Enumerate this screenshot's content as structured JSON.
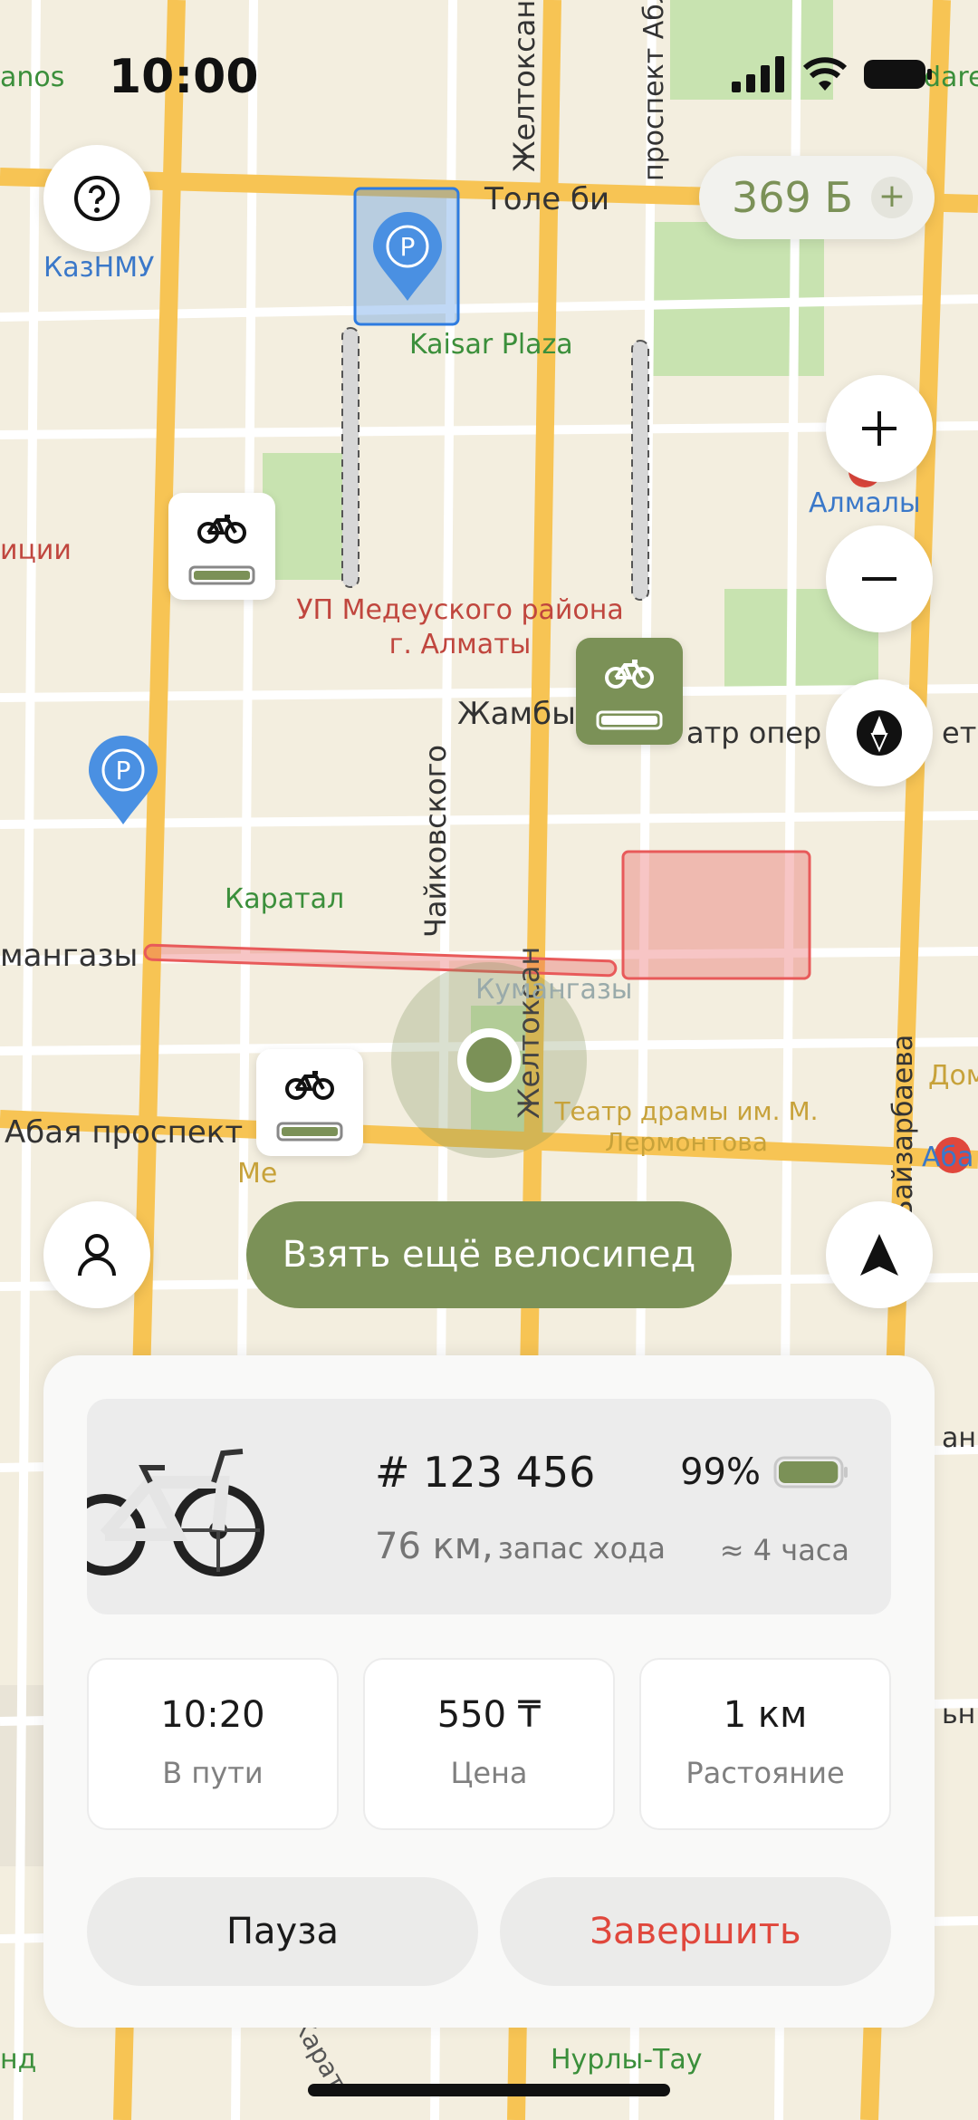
{
  "status_bar": {
    "time": "10:00"
  },
  "map": {
    "streets": [
      "Толе би",
      "Желтоксан",
      "проспект Абл",
      "Жамбыл",
      "Чайковского",
      "мангазы",
      "Абая проспект",
      "Байзарбаева",
      "Желтоксан",
      "Кумангазы",
      "Карат"
    ],
    "places": [
      "КазНМУ",
      "Kaisar Plaza",
      "УП Медеуского района г. Алматы",
      "Алмалы",
      "Каратал",
      "Театр драмы им. М. Лермонтова",
      "атр опер",
      "ета",
      "Нурлы-Тау",
      "Дом",
      "Аба",
      "anos",
      "dare",
      "иции",
      "нд",
      "ан",
      "ьн",
      "Ме"
    ]
  },
  "balance": {
    "value": "369 Б",
    "plus": "+"
  },
  "cta": {
    "label": "Взять ещё велосипед"
  },
  "bike": {
    "id": "# 123 456",
    "battery_percent_label": "99%",
    "battery_level": 0.99,
    "range_value": "76 км,",
    "range_label": "запас хода",
    "time_left": "≈ 4 часа"
  },
  "stats": [
    {
      "value": "10:20",
      "label": "В пути"
    },
    {
      "value": "550 ₸",
      "label": "Цена"
    },
    {
      "value": "1 км",
      "label": "Растояние"
    }
  ],
  "actions": {
    "pause": "Пауза",
    "finish": "Завершить"
  },
  "colors": {
    "accent": "#7b9157",
    "danger": "#e0473c",
    "parking": "#4a90e2",
    "zone": "#e85a5a"
  },
  "icons": [
    "help-icon",
    "plus-icon",
    "minus-icon",
    "compass-icon",
    "profile-icon",
    "navigation-arrow-icon",
    "bicycle-icon",
    "battery-icon",
    "parking-pin-icon"
  ]
}
